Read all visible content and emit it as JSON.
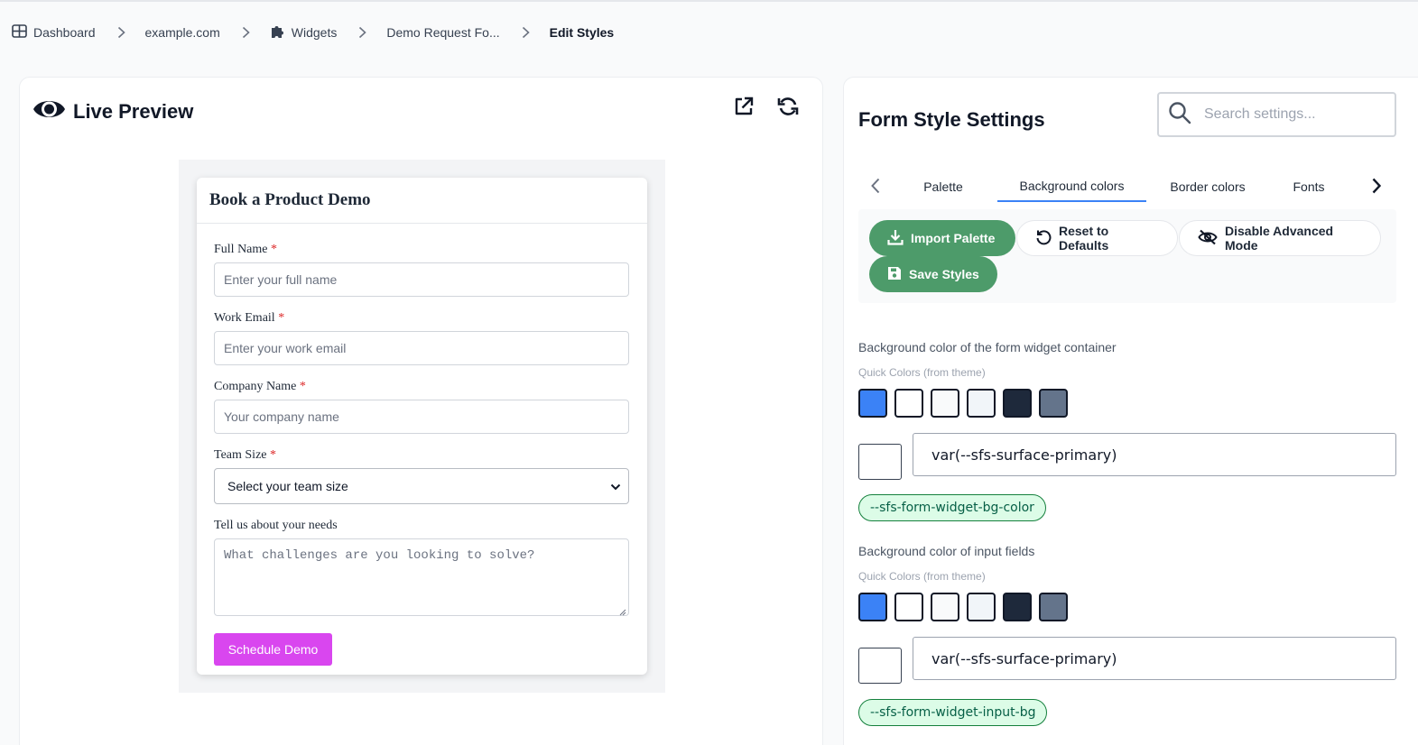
{
  "breadcrumb": {
    "items": [
      {
        "label": "Dashboard",
        "icon": "grid-icon"
      },
      {
        "label": "example.com"
      },
      {
        "label": "Widgets",
        "icon": "puzzle-icon"
      },
      {
        "label": "Demo Request Fo..."
      },
      {
        "label": "Edit Styles"
      }
    ]
  },
  "preview": {
    "title": "Live Preview",
    "form": {
      "title": "Book a Product Demo",
      "required_mark": "*",
      "fields": [
        {
          "label": "Full Name",
          "placeholder": "Enter your full name"
        },
        {
          "label": "Work Email",
          "placeholder": "Enter your work email"
        },
        {
          "label": "Company Name",
          "placeholder": "Your company name"
        },
        {
          "label": "Team Size",
          "value": "Select your team size"
        },
        {
          "label": "Tell us about your needs",
          "placeholder": "What challenges are you looking to solve?"
        }
      ],
      "submit_label": "Schedule Demo",
      "submit_color": "#d946ef"
    }
  },
  "settings": {
    "title": "Form Style Settings",
    "search_placeholder": "Search settings...",
    "tabs": [
      "Palette",
      "Background colors",
      "Border colors",
      "Fonts"
    ],
    "active_tab": "Background colors",
    "actions": {
      "import": "Import Palette",
      "reset": "Reset to Defaults",
      "disable_advanced": "Disable Advanced Mode",
      "save": "Save Styles"
    },
    "quick_colors_label": "Quick Colors (from theme)",
    "swatch_colors": [
      "#3b82f6",
      "#ffffff",
      "#f9fafb",
      "#f1f5f9",
      "#1e293b",
      "#64748b"
    ],
    "sections": [
      {
        "label": "Background color of the form widget container",
        "value": "var(--sfs-surface-primary)",
        "variable": "--sfs-form-widget-bg-color"
      },
      {
        "label": "Background color of input fields",
        "value": "var(--sfs-surface-primary)",
        "variable": "--sfs-form-widget-input-bg"
      }
    ]
  }
}
